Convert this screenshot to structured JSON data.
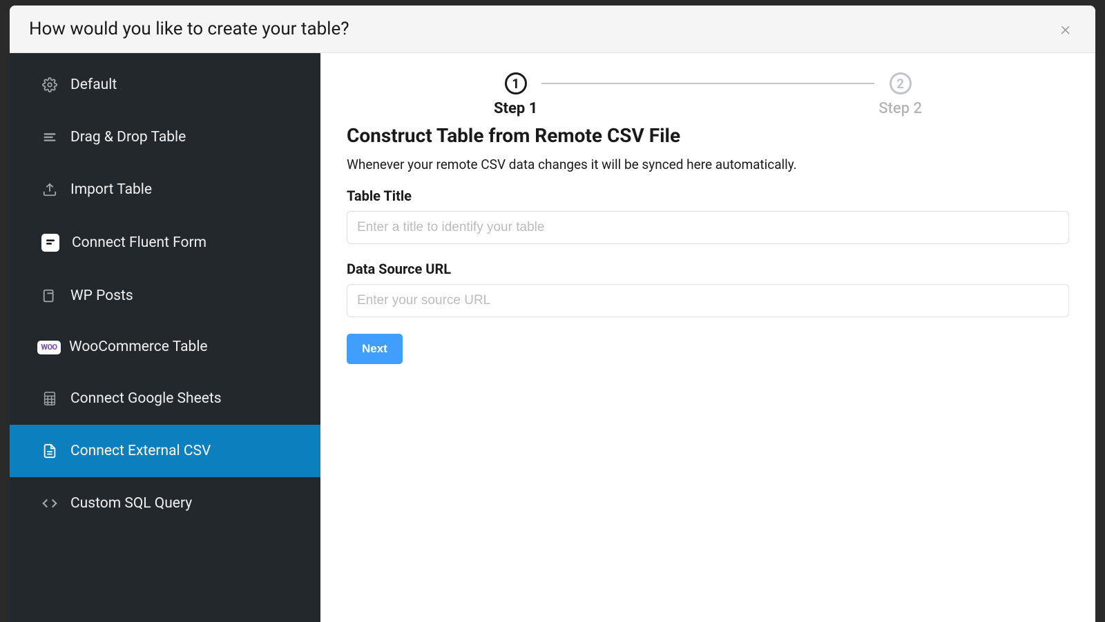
{
  "modal": {
    "title": "How would you like to create your table?"
  },
  "sidebar": {
    "items": [
      {
        "id": "default",
        "label": "Default"
      },
      {
        "id": "drag-drop",
        "label": "Drag & Drop Table"
      },
      {
        "id": "import",
        "label": "Import Table"
      },
      {
        "id": "fluent-form",
        "label": "Connect Fluent Form"
      },
      {
        "id": "wp-posts",
        "label": "WP Posts"
      },
      {
        "id": "woocommerce",
        "label": "WooCommerce Table"
      },
      {
        "id": "google-sheets",
        "label": "Connect Google Sheets"
      },
      {
        "id": "external-csv",
        "label": "Connect External CSV"
      },
      {
        "id": "custom-sql",
        "label": "Custom SQL Query"
      }
    ]
  },
  "woo_badge": "WOO",
  "stepper": {
    "steps": [
      {
        "num": "1",
        "label": "Step 1"
      },
      {
        "num": "2",
        "label": "Step 2"
      }
    ]
  },
  "main": {
    "heading": "Construct Table from Remote CSV File",
    "description": "Whenever your remote CSV data changes it will be synced here automatically.",
    "fields": {
      "title": {
        "label": "Table Title",
        "placeholder": "Enter a title to identify your table",
        "value": ""
      },
      "source": {
        "label": "Data Source URL",
        "placeholder": "Enter your source URL",
        "value": ""
      }
    },
    "next_button": "Next"
  }
}
